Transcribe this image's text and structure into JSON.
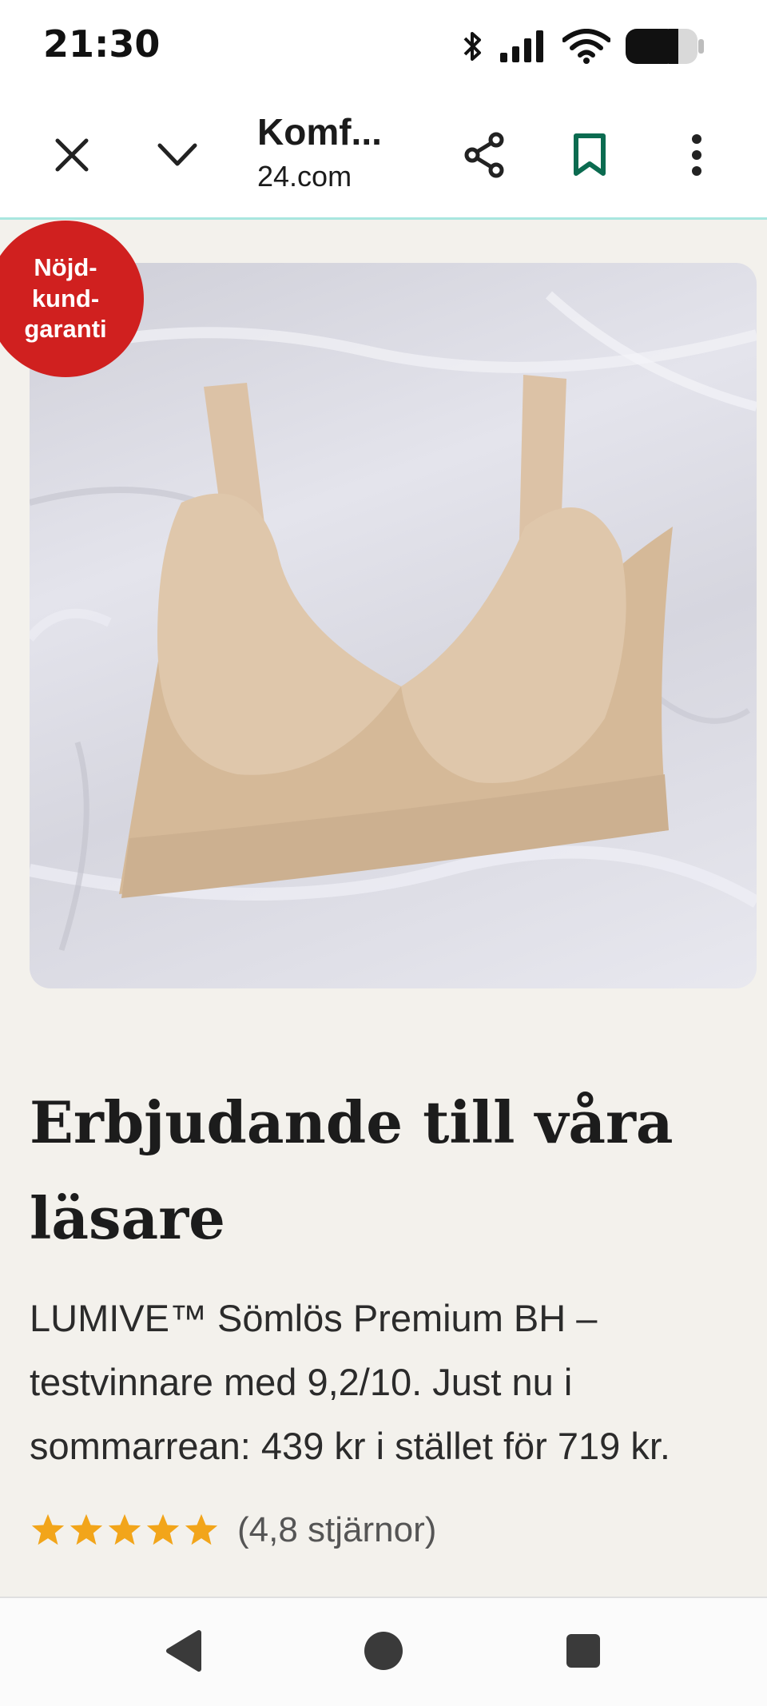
{
  "status_bar": {
    "time": "21:30",
    "icons": [
      "bluetooth-icon",
      "signal-icon",
      "wifi-icon",
      "battery-icon"
    ]
  },
  "browser": {
    "page_title": "Komf...",
    "domain": "24.com",
    "buttons": [
      "close-icon",
      "chevron-down-icon",
      "share-icon",
      "bookmark-icon",
      "more-vert-icon"
    ],
    "accent_color": "#0b6b50"
  },
  "badge": {
    "text": "Nöjd-kund-garanti",
    "color": "#d0201f"
  },
  "article": {
    "headline": "Erbjudande till våra läsare",
    "description": "LUMIVE™ Sömlös Premium BH – testvinnare med 9,2/10. Just nu i sommarrean: 439 kr i stället för 719 kr.",
    "rating": {
      "stars": 5,
      "text": "(4,8 stjärnor)",
      "star_color": "#f2a51a"
    }
  },
  "nav_bar": {
    "buttons": [
      "back-icon",
      "home-icon",
      "recents-icon"
    ]
  }
}
